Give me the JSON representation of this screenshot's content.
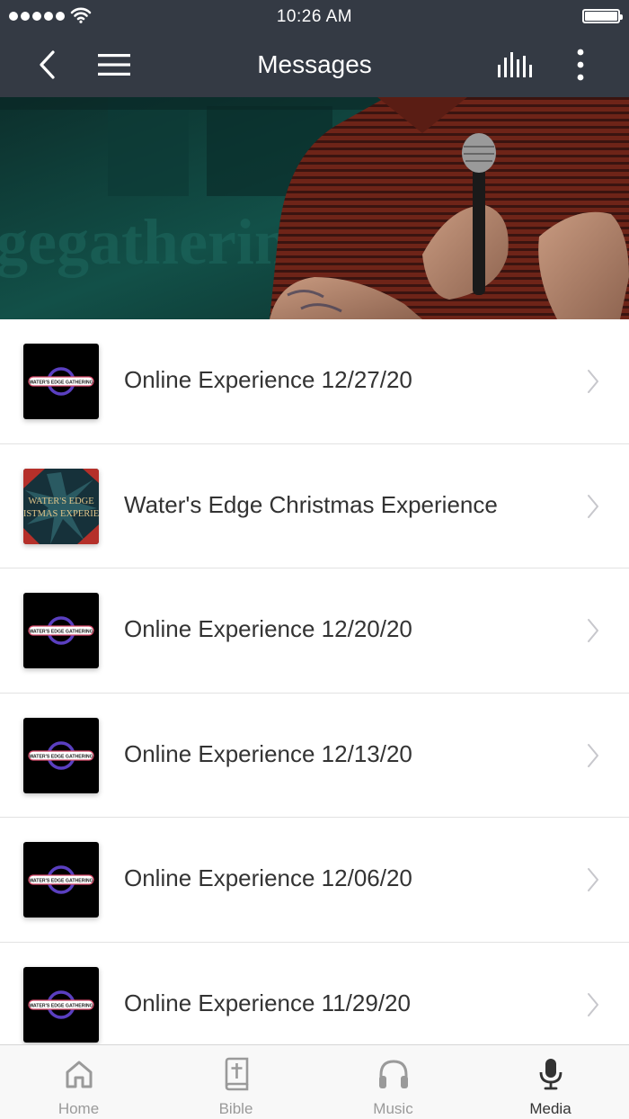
{
  "status_bar": {
    "time": "10:26 AM"
  },
  "nav": {
    "title": "Messages",
    "icons": [
      "back-icon",
      "menu-icon",
      "stats-icon",
      "more-icon"
    ]
  },
  "hero": {
    "background_text": "gegatherin"
  },
  "messages": [
    {
      "title": "Online Experience 12/27/20",
      "thumb": "WATER'S EDGE GATHERING"
    },
    {
      "title": "Water's Edge Christmas Experience",
      "thumb": "WATER'S EDGE",
      "thumb_sub": "ISTMAS EXPERIE"
    },
    {
      "title": "Online Experience 12/20/20",
      "thumb": "WATER'S EDGE GATHERING"
    },
    {
      "title": "Online Experience 12/13/20",
      "thumb": "WATER'S EDGE GATHERING"
    },
    {
      "title": "Online Experience 12/06/20",
      "thumb": "WATER'S EDGE GATHERING"
    },
    {
      "title": "Online Experience 11/29/20",
      "thumb": "WATER'S EDGE GATHERING"
    }
  ],
  "tabs": [
    {
      "label": "Home",
      "icon": "home-icon"
    },
    {
      "label": "Bible",
      "icon": "bible-icon"
    },
    {
      "label": "Music",
      "icon": "headphones-icon"
    },
    {
      "label": "Media",
      "icon": "microphone-icon",
      "active": true
    }
  ],
  "colors": {
    "nav_bg": "#343a44",
    "text": "#333333",
    "tab_inactive": "#9a9a9a",
    "divider": "#e2e2e2"
  }
}
